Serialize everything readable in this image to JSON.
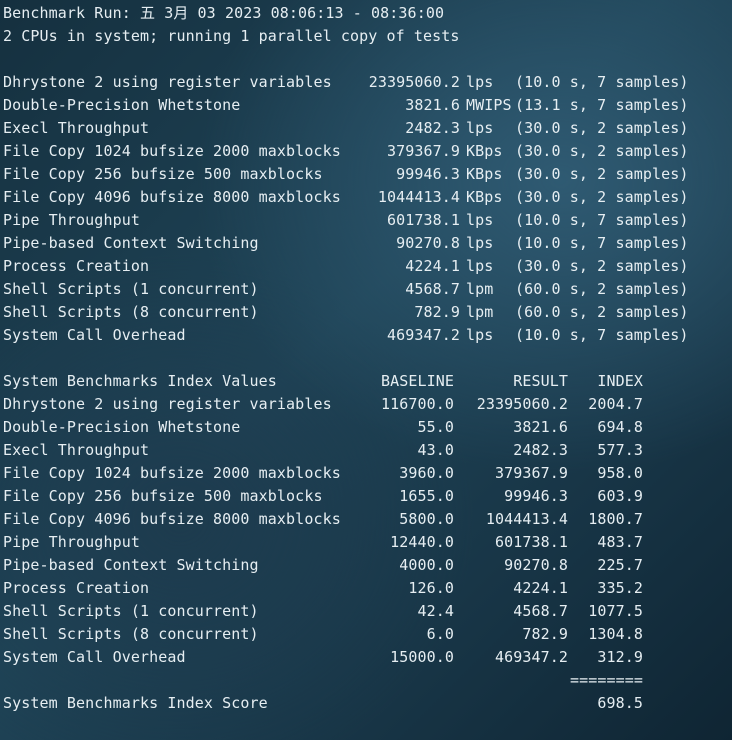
{
  "header": {
    "run_line": "Benchmark Run: 五 3月 03 2023 08:06:13 - 08:36:00",
    "cpu_line": "2 CPUs in system; running 1 parallel copy of tests"
  },
  "results": [
    {
      "name": "Dhrystone 2 using register variables",
      "value": "23395060.2",
      "unit": "lps",
      "detail": "(10.0 s, 7 samples)"
    },
    {
      "name": "Double-Precision Whetstone",
      "value": "3821.6",
      "unit": "MWIPS",
      "detail": "(13.1 s, 7 samples)"
    },
    {
      "name": "Execl Throughput",
      "value": "2482.3",
      "unit": "lps",
      "detail": "(30.0 s, 2 samples)"
    },
    {
      "name": "File Copy 1024 bufsize 2000 maxblocks",
      "value": "379367.9",
      "unit": "KBps",
      "detail": "(30.0 s, 2 samples)"
    },
    {
      "name": "File Copy 256 bufsize 500 maxblocks",
      "value": "99946.3",
      "unit": "KBps",
      "detail": "(30.0 s, 2 samples)"
    },
    {
      "name": "File Copy 4096 bufsize 8000 maxblocks",
      "value": "1044413.4",
      "unit": "KBps",
      "detail": "(30.0 s, 2 samples)"
    },
    {
      "name": "Pipe Throughput",
      "value": "601738.1",
      "unit": "lps",
      "detail": "(10.0 s, 7 samples)"
    },
    {
      "name": "Pipe-based Context Switching",
      "value": "90270.8",
      "unit": "lps",
      "detail": "(10.0 s, 7 samples)"
    },
    {
      "name": "Process Creation",
      "value": "4224.1",
      "unit": "lps",
      "detail": "(30.0 s, 2 samples)"
    },
    {
      "name": "Shell Scripts (1 concurrent)",
      "value": "4568.7",
      "unit": "lpm",
      "detail": "(60.0 s, 2 samples)"
    },
    {
      "name": "Shell Scripts (8 concurrent)",
      "value": "782.9",
      "unit": "lpm",
      "detail": "(60.0 s, 2 samples)"
    },
    {
      "name": "System Call Overhead",
      "value": "469347.2",
      "unit": "lps",
      "detail": "(10.0 s, 7 samples)"
    }
  ],
  "index_table": {
    "title": "System Benchmarks Index Values",
    "col_baseline": "BASELINE",
    "col_result": "RESULT",
    "col_index": "INDEX",
    "rows": [
      {
        "name": "Dhrystone 2 using register variables",
        "baseline": "116700.0",
        "result": "23395060.2",
        "index": "2004.7"
      },
      {
        "name": "Double-Precision Whetstone",
        "baseline": "55.0",
        "result": "3821.6",
        "index": "694.8"
      },
      {
        "name": "Execl Throughput",
        "baseline": "43.0",
        "result": "2482.3",
        "index": "577.3"
      },
      {
        "name": "File Copy 1024 bufsize 2000 maxblocks",
        "baseline": "3960.0",
        "result": "379367.9",
        "index": "958.0"
      },
      {
        "name": "File Copy 256 bufsize 500 maxblocks",
        "baseline": "1655.0",
        "result": "99946.3",
        "index": "603.9"
      },
      {
        "name": "File Copy 4096 bufsize 8000 maxblocks",
        "baseline": "5800.0",
        "result": "1044413.4",
        "index": "1800.7"
      },
      {
        "name": "Pipe Throughput",
        "baseline": "12440.0",
        "result": "601738.1",
        "index": "483.7"
      },
      {
        "name": "Pipe-based Context Switching",
        "baseline": "4000.0",
        "result": "90270.8",
        "index": "225.7"
      },
      {
        "name": "Process Creation",
        "baseline": "126.0",
        "result": "4224.1",
        "index": "335.2"
      },
      {
        "name": "Shell Scripts (1 concurrent)",
        "baseline": "42.4",
        "result": "4568.7",
        "index": "1077.5"
      },
      {
        "name": "Shell Scripts (8 concurrent)",
        "baseline": "6.0",
        "result": "782.9",
        "index": "1304.8"
      },
      {
        "name": "System Call Overhead",
        "baseline": "15000.0",
        "result": "469347.2",
        "index": "312.9"
      }
    ],
    "separator": "========",
    "score_label": "System Benchmarks Index Score",
    "score_value": "698.5"
  }
}
